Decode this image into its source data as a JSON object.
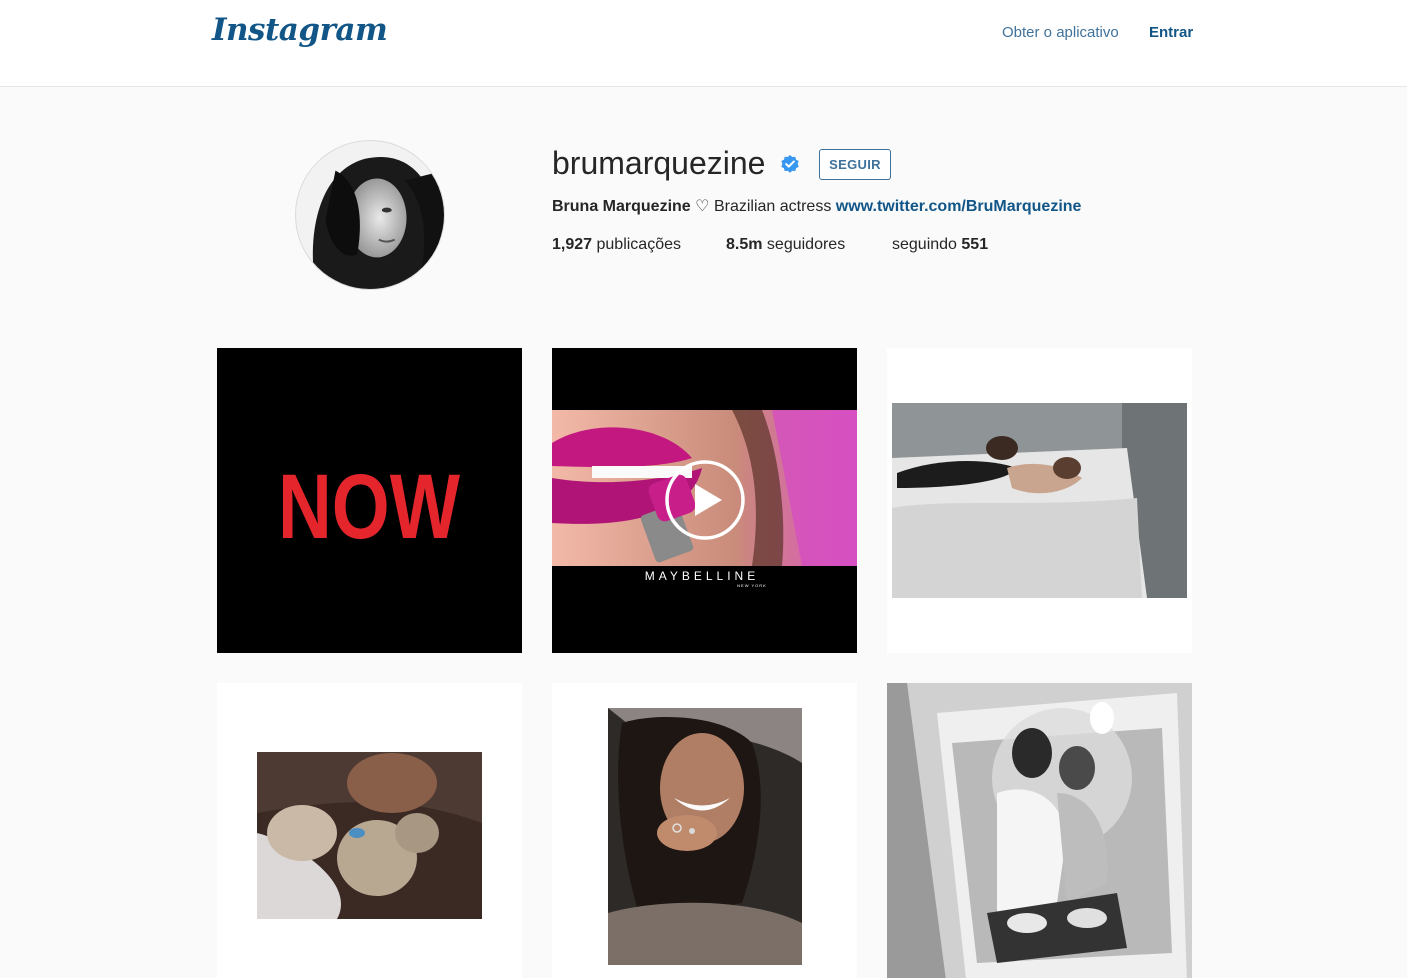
{
  "header": {
    "logo": "Instagram",
    "get_app": "Obter o aplicativo",
    "login": "Entrar"
  },
  "profile": {
    "username": "brumarquezine",
    "follow_label": "SEGUIR",
    "full_name": "Bruna Marquezine",
    "bio_heart": "♡",
    "bio_text": "Brazilian actress",
    "link": "www.twitter.com/BruMarquezine",
    "stats": {
      "posts_count": "1,927",
      "posts_label": "publicações",
      "followers_count": "8.5m",
      "followers_label": "seguidores",
      "following_label": "seguindo",
      "following_count": "551"
    }
  },
  "posts": [
    {
      "kind": "image",
      "text": "NOW"
    },
    {
      "kind": "video",
      "text": "MAYBELLINE",
      "subtext": "NEW YORK"
    },
    {
      "kind": "image"
    },
    {
      "kind": "image"
    },
    {
      "kind": "image"
    },
    {
      "kind": "image"
    }
  ],
  "colors": {
    "accent": "#3f729b",
    "link": "#125688",
    "background": "#fafafa",
    "now_red": "#e4262c",
    "verified_blue": "#3897f0"
  }
}
